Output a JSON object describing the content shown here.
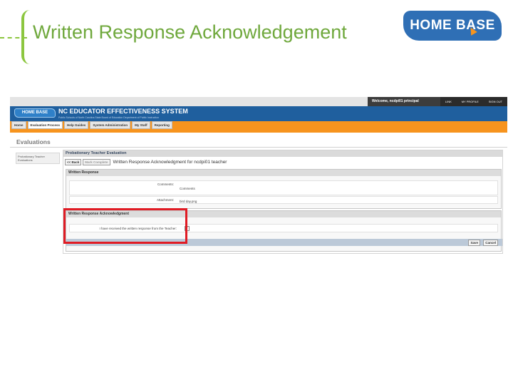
{
  "slide": {
    "title": "Written Response Acknowledgement",
    "logo_text": "HOME BASE"
  },
  "app": {
    "welcome_text": "Welcome, ncdpi01 principal",
    "top_nav": [
      "LINK",
      "MY PROFILE",
      "SIGN OUT"
    ],
    "header_logo": "HOME BASE",
    "system_title": "NC EDUCATOR EFFECTIVENESS SYSTEM",
    "system_subtitle": "Public Schools of North Carolina  State Board of Education  Department of Public Instruction",
    "tabs": [
      {
        "label": "Home"
      },
      {
        "label": "Evaluation Process"
      },
      {
        "label": "Help Guides"
      },
      {
        "label": "System Administration"
      },
      {
        "label": "My Staff"
      },
      {
        "label": "Reporting"
      }
    ],
    "section_title": "Evaluations",
    "sidebar_item": "Probationary Teacher Evaluations",
    "panel_title": "Probationary Teacher Evaluation",
    "back_button": "<< Back",
    "mark_complete_button": "Mark Complete",
    "ack_heading": "Written Response Acknowledgment for ncdpi01 teacher",
    "written_response": {
      "header": "Written Response",
      "comments_label": "Comments:",
      "comments_value": "Comments",
      "attachment_label": "Attachment:",
      "attachment_value": "bird day.png"
    },
    "acknowledgment": {
      "header": "Written Response Acknowledgment",
      "label": "I have received the written response from the Teacher:",
      "checked_mark": "✓"
    },
    "save_button": "Save",
    "cancel_button": "Cancel"
  },
  "colors": {
    "title_green": "#6fa83c",
    "brand_blue": "#1f5f9e",
    "tab_orange": "#f7941e",
    "highlight_red": "#e01b24"
  }
}
